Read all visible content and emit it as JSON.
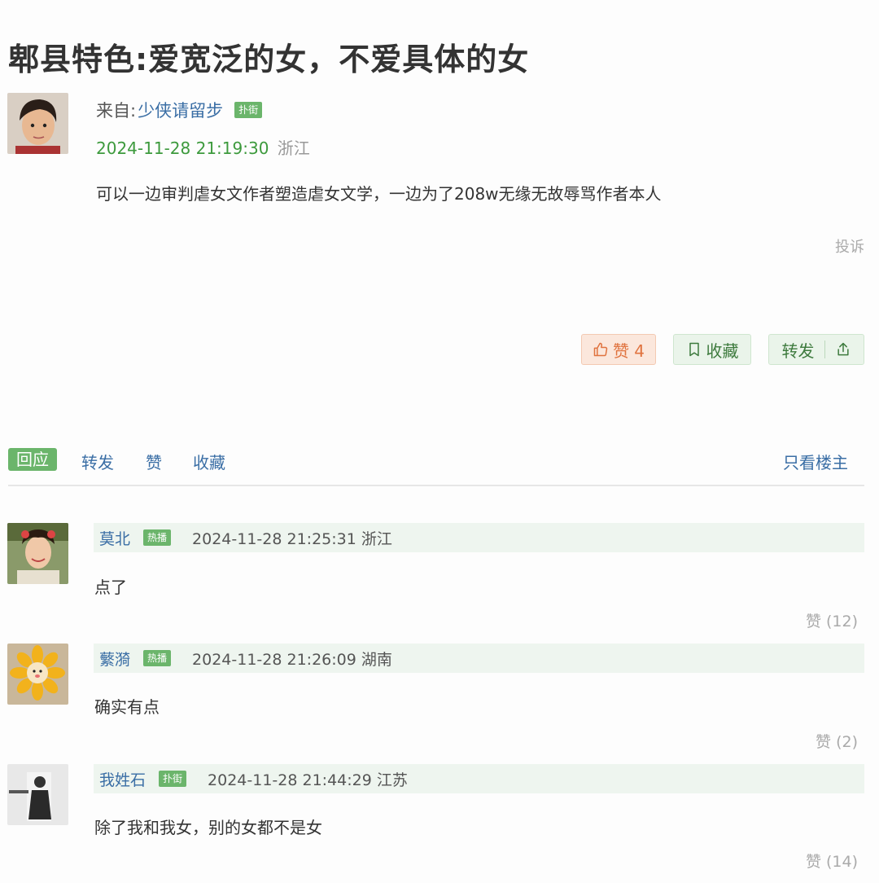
{
  "post": {
    "title": "郫县特色:爱宽泛的女，不爱具体的女",
    "from_label": "来自:",
    "author": "少侠请留步",
    "author_tag": "扑街",
    "time": "2024-11-28 21:19:30",
    "location": "浙江",
    "content": "可以一边审判虐女文作者塑造虐女文学，一边为了208w无缘无故辱骂作者本人",
    "report": "投诉",
    "like_label": "赞 4",
    "fav_label": "收藏",
    "share_label": "转发"
  },
  "actions": {
    "reply": "回应",
    "repost": "转发",
    "like": "赞",
    "collect": "收藏",
    "only_op": "只看楼主"
  },
  "comments": [
    {
      "name": "莫北",
      "tag": "热播",
      "meta": "2024-11-28 21:25:31 浙江",
      "text": "点了",
      "likes": "赞 (12)"
    },
    {
      "name": "蘩漪",
      "tag": "热播",
      "meta": "2024-11-28 21:26:09 湖南",
      "text": "确实有点",
      "likes": "赞 (2)"
    },
    {
      "name": "我姓石",
      "tag": "扑街",
      "meta": "2024-11-28 21:44:29 江苏",
      "text": "除了我和我女，别的女都不是女",
      "likes": "赞 (14)"
    }
  ],
  "icons": {
    "like": "thumbs-up-icon",
    "fav": "bookmark-icon",
    "share": "share-icon"
  },
  "colors": {
    "accent_green": "#6bb56b",
    "link_blue": "#3a6ea5",
    "time_green": "#3d9a3d",
    "like_orange": "#e0733f"
  }
}
